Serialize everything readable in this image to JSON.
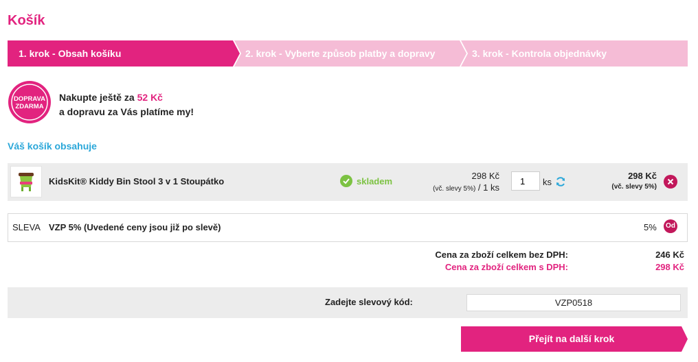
{
  "page": {
    "title": "Košík"
  },
  "steps": [
    {
      "label": "1. krok - Obsah košíku",
      "active": true
    },
    {
      "label": "2. krok - Vyberte způsob platby a dopravy",
      "active": false
    },
    {
      "label": "3. krok - Kontrola objednávky",
      "active": false
    }
  ],
  "promo": {
    "badge_line1": "DOPRAVA",
    "badge_line2": "ZDARMA",
    "line1_prefix": "Nakupte ještě za ",
    "amount": "52 Kč",
    "line2": "a dopravu za Vás platíme my!"
  },
  "cart": {
    "heading": "Váš košík obsahuje",
    "item": {
      "name": "KidsKit® Kiddy Bin Stool 3 v 1 Stoupátko",
      "stock": "skladem",
      "unit_price": "298 Kč",
      "unit_price_note": "(vč. slevy 5%)",
      "unit_per": " / 1 ks",
      "quantity": "1",
      "qty_unit": "ks",
      "total_price": "298 Kč",
      "total_note": "(vč. slevy 5%)"
    },
    "discount": {
      "label": "SLEVA",
      "name": "VZP 5% (Uvedené ceny jsou již po slevě)",
      "value": "5%",
      "remove_label": "Od"
    }
  },
  "summary": {
    "without_vat_label": "Cena za zboží celkem bez DPH:",
    "without_vat_value": "246 Kč",
    "with_vat_label": "Cena za zboží celkem s DPH:",
    "with_vat_value": "298 Kč"
  },
  "coupon": {
    "label": "Zadejte slevový kód:",
    "value": "VZP0518"
  },
  "next_button": "Přejít na další krok",
  "colors": {
    "brand": "#e2237f",
    "brand_light": "#f5bcd6",
    "link_blue": "#2aa7d9",
    "stock_green": "#7cc242",
    "remove": "#c2185b"
  }
}
